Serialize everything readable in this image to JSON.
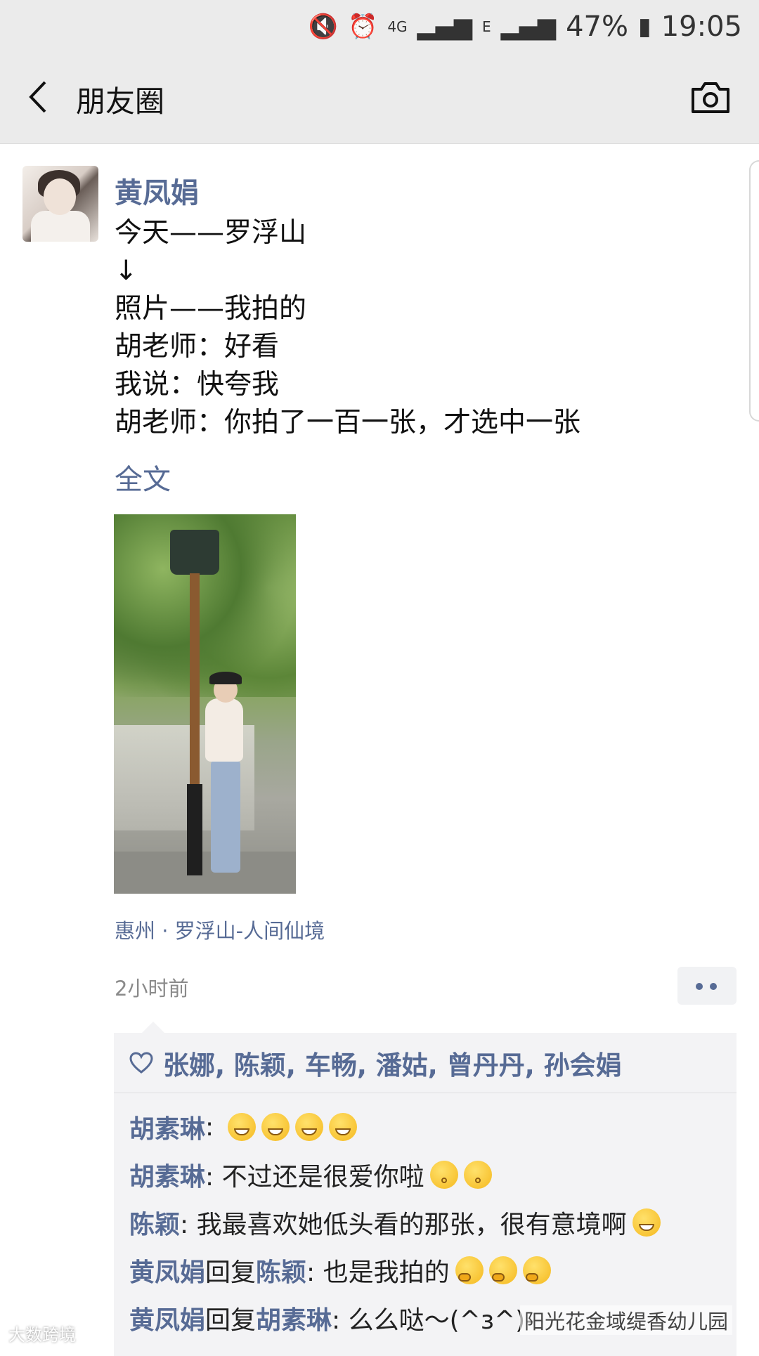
{
  "status_bar": {
    "battery": "47%",
    "time": "19:05",
    "network_4g": "4G",
    "network_e": "E",
    "icons": [
      "mute-icon",
      "alarm-icon",
      "signal-icon",
      "battery-icon"
    ]
  },
  "nav": {
    "title": "朋友圈",
    "back_icon": "chevron-left-icon",
    "camera_icon": "camera-icon"
  },
  "post": {
    "author": "黄凤娟",
    "lines": [
      "今天——罗浮山",
      "↓",
      "照片——我拍的",
      "胡老师：好看",
      "我说：快夸我",
      "胡老师：你拍了一百一张，才选中一张"
    ],
    "full_text_link": "全文",
    "location": "惠州 · 罗浮山-人间仙境",
    "time_ago": "2小时前"
  },
  "likes": {
    "names": "张娜, 陈颖, 车畅, 潘姑, 曾丹丹, 孙会娟"
  },
  "comments": [
    {
      "name": "胡素琳",
      "text": ": ",
      "emojis": [
        "grin",
        "grin",
        "grin",
        "grin"
      ]
    },
    {
      "name": "胡素琳",
      "text": ": 不过还是很爱你啦",
      "emojis": [
        "kiss",
        "kiss"
      ]
    },
    {
      "name": "陈颖",
      "text": ": 我最喜欢她低头看的那张，很有意境啊",
      "emojis": [
        "grin"
      ]
    },
    {
      "name": "黄凤娟",
      "reply_word": "回复",
      "reply_to": "陈颖",
      "text": ": 也是我拍的",
      "emojis": [
        "think",
        "think",
        "think"
      ]
    },
    {
      "name": "黄凤娟",
      "reply_word": "回复",
      "reply_to": "胡素琳",
      "text": ": 么么哒～(^з^)-",
      "emojis": []
    }
  ],
  "watermarks": {
    "left": "大数跨境",
    "right": "阳光花金域缇香幼儿园"
  },
  "colors": {
    "link_blue": "#576b95",
    "bar_gray": "#ebebeb",
    "comment_bg": "#f3f3f5"
  }
}
